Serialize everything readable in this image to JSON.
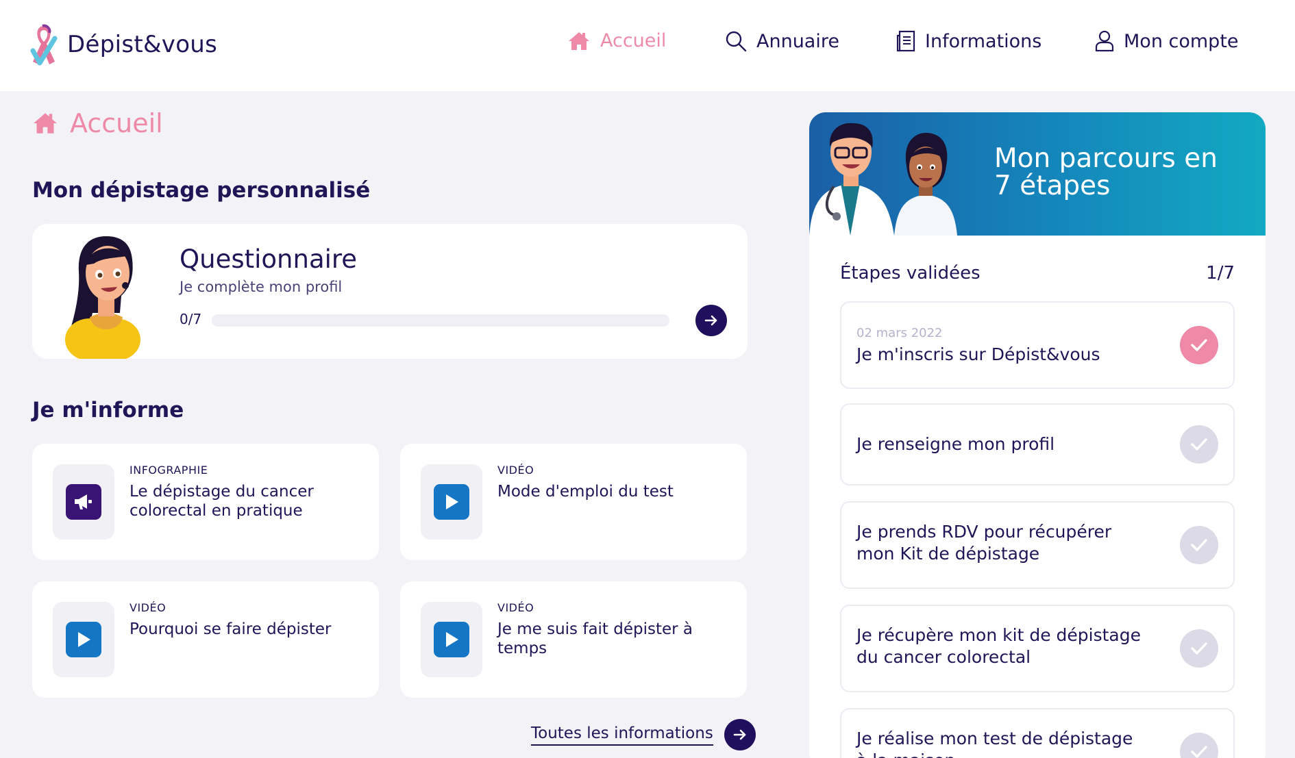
{
  "app": {
    "name": "Dépist&vous"
  },
  "nav": {
    "accueil": "Accueil",
    "annuaire": "Annuaire",
    "informations": "Informations",
    "compte": "Mon compte"
  },
  "page": {
    "title": "Accueil"
  },
  "screening": {
    "section_title": "Mon dépistage personnalisé",
    "questionnaire": {
      "title": "Questionnaire",
      "subtitle": "Je complète mon profil",
      "progress_label": "0/7",
      "progress_fraction": 0
    }
  },
  "inform": {
    "section_title": "Je m'informe",
    "cards": [
      {
        "type": "INFOGRAPHIE",
        "title": "Le dépistage du cancer colorectal en pratique",
        "icon": "megaphone-icon",
        "icon_color": "#3a1475"
      },
      {
        "type": "VIDÉO",
        "title": "Mode d'emploi du test",
        "icon": "play-icon",
        "icon_color": "#1476c4"
      },
      {
        "type": "VIDÉO",
        "title": "Pourquoi se faire dépister",
        "icon": "play-icon",
        "icon_color": "#1476c4"
      },
      {
        "type": "VIDÉO",
        "title": "Je me suis fait dépister à temps",
        "icon": "play-icon",
        "icon_color": "#1476c4"
      }
    ],
    "all_link": "Toutes les informations"
  },
  "parcours": {
    "banner_title": "Mon parcours en 7 étapes",
    "steps_label": "Étapes validées",
    "steps_count": "1/7",
    "steps": [
      {
        "date": "02 mars 2022",
        "label": "Je m'inscris sur Dépist&vous",
        "done": true
      },
      {
        "date": "",
        "label": "Je renseigne mon profil",
        "done": false
      },
      {
        "date": "",
        "label": "Je prends RDV pour récupérer mon Kit de dépistage",
        "done": false
      },
      {
        "date": "",
        "label": "Je récupère mon kit de dépistage du cancer colorectal",
        "done": false
      },
      {
        "date": "",
        "label": "Je réalise mon test de dépistage à la maison",
        "done": false
      }
    ]
  },
  "colors": {
    "brand_navy": "#1f1657",
    "accent_pink": "#ee8aa7",
    "check_pending": "#dcdae6",
    "background": "#f3f2f7"
  }
}
